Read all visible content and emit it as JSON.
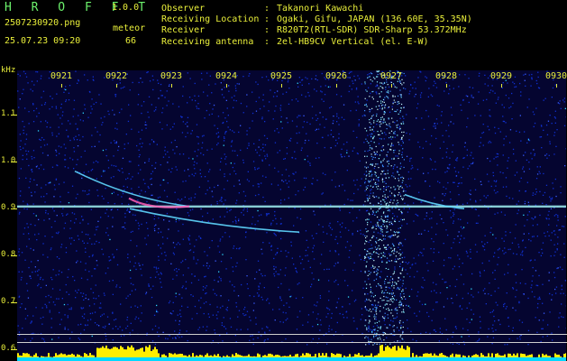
{
  "header": {
    "brand": "H R O F F T",
    "version": "1.0.0",
    "file": "2507230920.png",
    "mode": "meteor",
    "datetime": "25.07.23 09:20",
    "count": "66"
  },
  "info": [
    {
      "key": "Observer",
      "sep": ":",
      "value": "Takanori Kawachi"
    },
    {
      "key": "Receiving Location",
      "sep": ":",
      "value": "Ogaki, Gifu, JAPAN (136.60E, 35.35N)"
    },
    {
      "key": "Receiver",
      "sep": ":",
      "value": "R820T2(RTL-SDR) SDR-Sharp 53.372MHz"
    },
    {
      "key": "Receiving antenna",
      "sep": ":",
      "value": "2el-HB9CV Vertical (el. E-W)"
    }
  ],
  "chart_data": {
    "type": "heatmap",
    "title": "",
    "ylabel": "kHz",
    "yticks": [
      "1.1",
      "1.0",
      "0.9",
      "0.8",
      "0.7",
      "0.6"
    ],
    "ylim": [
      0.575,
      1.195
    ],
    "xticks": [
      "0921",
      "0922",
      "0923",
      "0924",
      "0925",
      "0926",
      "0927",
      "0928",
      "0929",
      "0930"
    ],
    "carrier_khz": 0.905,
    "meteor_traces": [
      {
        "x_from": "0921",
        "x_to": "0923",
        "y_from": 0.98,
        "y_to": 0.905
      },
      {
        "x_from": "0922",
        "x_to": "0925",
        "y_from": 0.9,
        "y_to": 0.85
      },
      {
        "x_from": "0927",
        "x_to": "0928",
        "y_from": 0.93,
        "y_to": 0.9
      }
    ],
    "noise_burst_minute": "0927"
  },
  "colors": {
    "background": "#000000",
    "label": "#e9ef3a",
    "brand": "#6cf26c",
    "noise": "#1030d0",
    "carrier": "#9ff0f0",
    "meteor": "#ff5fb5",
    "bar_top": "#ffee00",
    "bar_base": "#00d8ff"
  }
}
